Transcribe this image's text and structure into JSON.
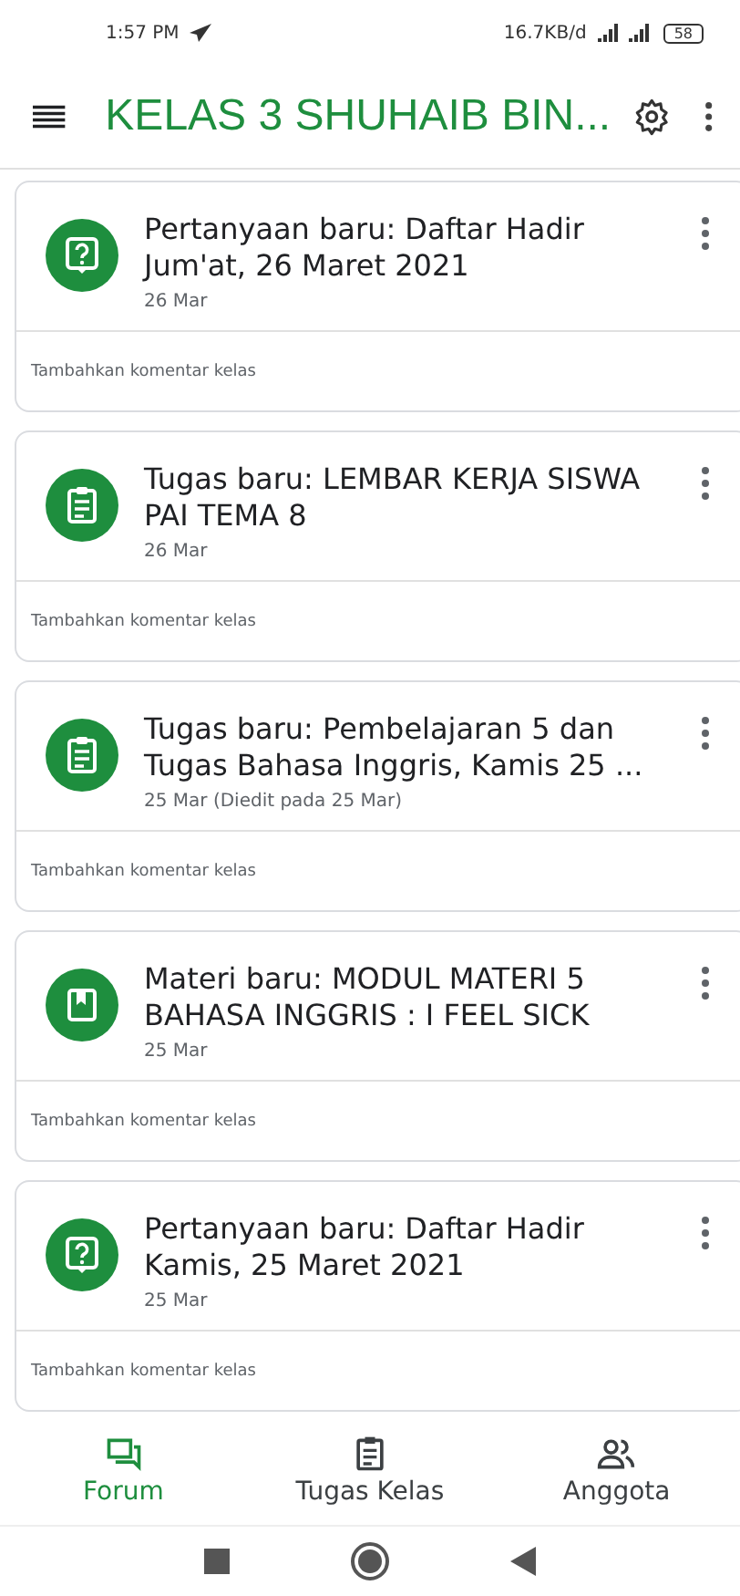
{
  "status_bar": {
    "time": "1:57 PM",
    "speed": "16.7KB/d",
    "battery": "58"
  },
  "app_bar": {
    "title": "KELAS 3 SHUHAIB BIN..."
  },
  "posts": [
    {
      "kind": "question",
      "title": "Pertanyaan baru: Daftar Hadir Jum'at, 26 Maret 2021",
      "date": "26 Mar",
      "comment_placeholder": "Tambahkan komentar kelas"
    },
    {
      "kind": "assignment",
      "title": "Tugas baru: LEMBAR KERJA SISWA PAI TEMA 8",
      "date": "26 Mar",
      "comment_placeholder": "Tambahkan komentar kelas"
    },
    {
      "kind": "assignment",
      "title": "Tugas baru: Pembelajaran 5 dan Tugas Bahasa Inggris, Kamis 25 ...",
      "date": "25 Mar (Diedit pada 25 Mar)",
      "comment_placeholder": "Tambahkan komentar kelas"
    },
    {
      "kind": "material",
      "title": "Materi baru: MODUL MATERI 5 BAHASA INGGRIS : I FEEL SICK",
      "date": "25 Mar",
      "comment_placeholder": "Tambahkan komentar kelas"
    },
    {
      "kind": "question",
      "title": "Pertanyaan baru: Daftar Hadir Kamis, 25 Maret 2021",
      "date": "25 Mar",
      "comment_placeholder": "Tambahkan komentar kelas"
    }
  ],
  "bottom_nav": [
    {
      "kind": "forum",
      "label": "Forum",
      "selected": true
    },
    {
      "kind": "classwork",
      "label": "Tugas Kelas",
      "selected": false
    },
    {
      "kind": "people",
      "label": "Anggota",
      "selected": false
    }
  ]
}
